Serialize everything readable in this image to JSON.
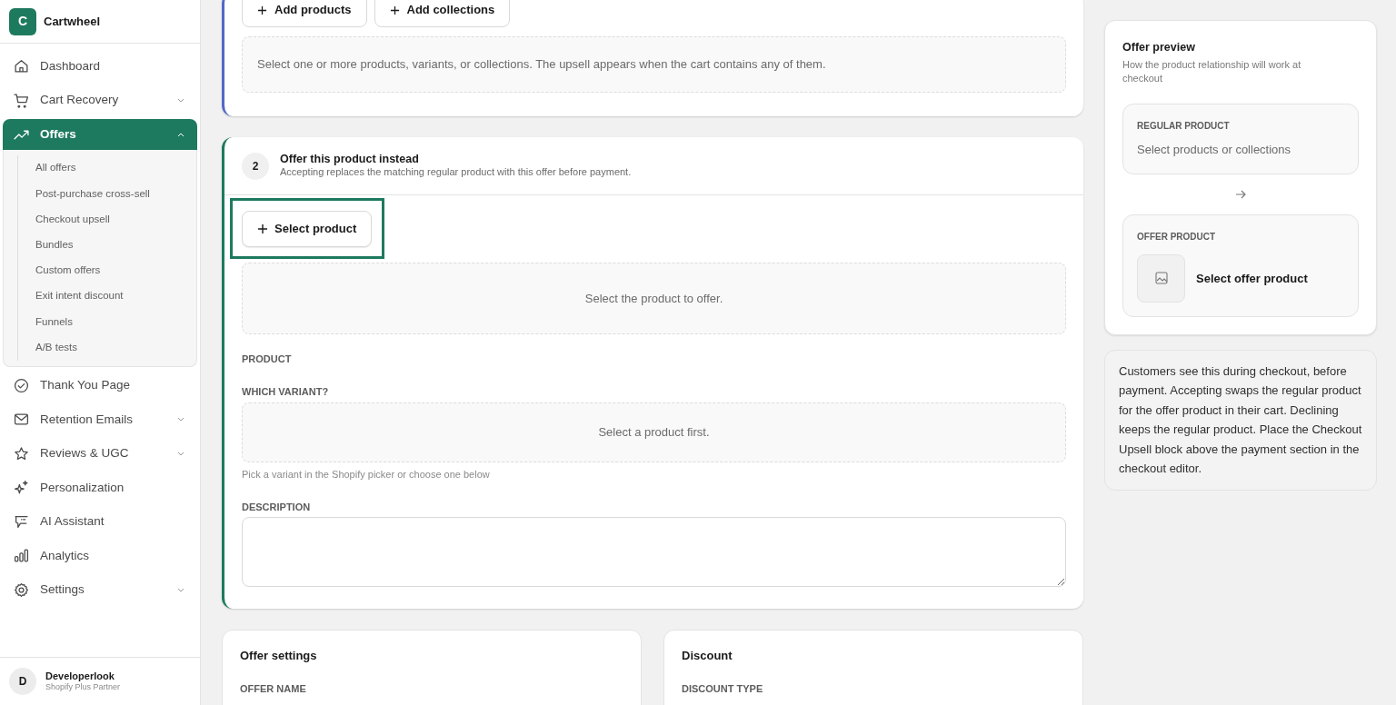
{
  "brand": {
    "logo_letter": "C",
    "name": "Cartwheel"
  },
  "nav": [
    {
      "label": "Dashboard",
      "kind": "link",
      "selected": false
    },
    {
      "label": "Cart Recovery",
      "kind": "group",
      "expanded": false,
      "selected": false
    },
    {
      "label": "Offers",
      "kind": "group",
      "expanded": true,
      "selected": true,
      "children": [
        {
          "label": "All offers",
          "selected": false
        },
        {
          "label": "Post-purchase cross-sell",
          "selected": false
        },
        {
          "label": "Checkout upsell",
          "selected": false
        },
        {
          "label": "Bundles",
          "selected": false
        },
        {
          "label": "Custom offers",
          "selected": false
        },
        {
          "label": "Exit intent discount",
          "selected": false
        },
        {
          "label": "Funnels",
          "selected": false
        },
        {
          "label": "A/B tests",
          "selected": false
        }
      ]
    },
    {
      "label": "Thank You Page",
      "kind": "link",
      "selected": false
    },
    {
      "label": "Retention Emails",
      "kind": "group",
      "expanded": false,
      "selected": false
    },
    {
      "label": "Reviews & UGC",
      "kind": "group",
      "expanded": false,
      "selected": false
    },
    {
      "label": "Personalization",
      "kind": "link",
      "selected": false
    },
    {
      "label": "AI Assistant",
      "kind": "link",
      "selected": false
    },
    {
      "label": "Analytics",
      "kind": "link",
      "selected": false
    },
    {
      "label": "Settings",
      "kind": "group",
      "expanded": false,
      "selected": false
    }
  ],
  "user": {
    "initial": "D",
    "name": "Developerlook",
    "role": "Shopify Plus Partner"
  },
  "step1": {
    "buttons": [
      "Add products",
      "Add collections"
    ],
    "empty_text": "Select one or more products, variants, or collections. The upsell appears when the cart contains any of them."
  },
  "step2": {
    "number": "2",
    "title": "Offer this product instead",
    "subtitle": "Accepting replaces the matching regular product with this offer before payment.",
    "select_button": "Select product",
    "empty_text": "Select the product to offer.",
    "product_label": "PRODUCT",
    "variant_label": "WHICH VARIANT?",
    "variant_empty": "Select a product first.",
    "variant_hint": "Pick a variant in the Shopify picker or choose one below",
    "description_label": "DESCRIPTION"
  },
  "offer_settings": {
    "title": "Offer settings",
    "field_label": "OFFER NAME"
  },
  "discount": {
    "title": "Discount",
    "field_label": "DISCOUNT TYPE"
  },
  "preview": {
    "title": "Offer preview",
    "subtitle": "How the product relationship will work at checkout",
    "regular_label": "REGULAR PRODUCT",
    "regular_value": "Select products or collections",
    "offer_label": "OFFER PRODUCT",
    "offer_value": "Select offer product"
  },
  "note": "Customers see this during checkout, before payment. Accepting swaps the regular product for the offer product in their cart. Declining keeps the regular product. Place the Checkout Upsell block above the payment section in the checkout editor."
}
